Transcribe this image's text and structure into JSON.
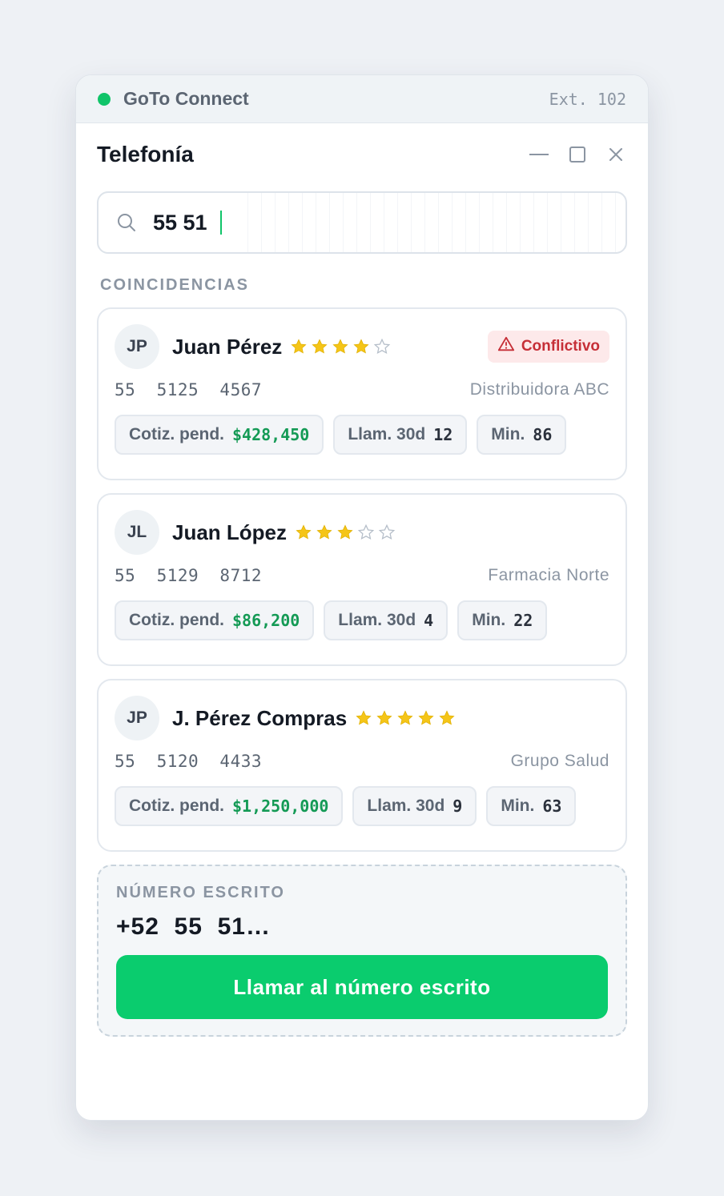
{
  "titlebar": {
    "app_name": "GoTo Connect",
    "extension": "Ext. 102",
    "status_color": "#10c469"
  },
  "header": {
    "title": "Telefonía"
  },
  "search": {
    "value": "55 51",
    "icon": "search-icon"
  },
  "results_label": "COINCIDENCIAS",
  "contacts": [
    {
      "initials": "JP",
      "name": "Juan Pérez",
      "rating": 4,
      "max_rating": 5,
      "badge": "Conflictivo",
      "phone": "55  5125  4567",
      "company": "Distribuidora ABC",
      "chips": [
        {
          "label": "Cotiz. pend.",
          "value": "$428,450",
          "money": true
        },
        {
          "label": "Llam. 30d",
          "value": "12",
          "money": false
        },
        {
          "label": "Min.",
          "value": "86",
          "money": false
        }
      ]
    },
    {
      "initials": "JL",
      "name": "Juan López",
      "rating": 3,
      "max_rating": 5,
      "badge": "",
      "phone": "55  5129  8712",
      "company": "Farmacia Norte",
      "chips": [
        {
          "label": "Cotiz. pend.",
          "value": "$86,200",
          "money": true
        },
        {
          "label": "Llam. 30d",
          "value": "4",
          "money": false
        },
        {
          "label": "Min.",
          "value": "22",
          "money": false
        }
      ]
    },
    {
      "initials": "JP",
      "name": "J. Pérez Compras",
      "rating": 5,
      "max_rating": 5,
      "badge": "",
      "phone": "55  5120  4433",
      "company": "Grupo Salud",
      "chips": [
        {
          "label": "Cotiz. pend.",
          "value": "$1,250,000",
          "money": true
        },
        {
          "label": "Llam. 30d",
          "value": "9",
          "money": false
        },
        {
          "label": "Min.",
          "value": "63",
          "money": false
        }
      ]
    }
  ],
  "typed": {
    "label": "NÚMERO ESCRITO",
    "number": "+52  55  51…",
    "call_label": "Llamar al número escrito"
  },
  "colors": {
    "accent": "#0acc6e",
    "money": "#149a55",
    "danger": "#c62f37",
    "star": "#f5c518"
  }
}
